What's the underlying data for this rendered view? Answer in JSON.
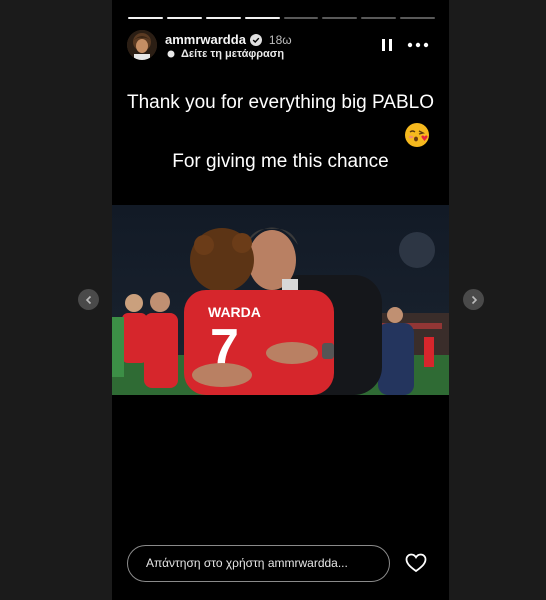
{
  "story": {
    "progress": {
      "segments": 8,
      "completed": 4
    },
    "user": {
      "username": "ammrwardda",
      "verified": true,
      "time": "18ω"
    },
    "translate_label": "Δείτε τη μετάφραση",
    "caption": {
      "line1": "Thank you for everything big PABLO",
      "emoji": "kissing-face-icon",
      "line2": "For giving me this chance"
    },
    "photo": {
      "jersey_name": "WARDA",
      "jersey_number": "7"
    },
    "reply": {
      "placeholder": "Απάντηση στο χρήστη ammrwardda..."
    }
  },
  "colors": {
    "background": "#1b1b1b",
    "story_bg": "#000000",
    "jersey": "#d6262c"
  }
}
